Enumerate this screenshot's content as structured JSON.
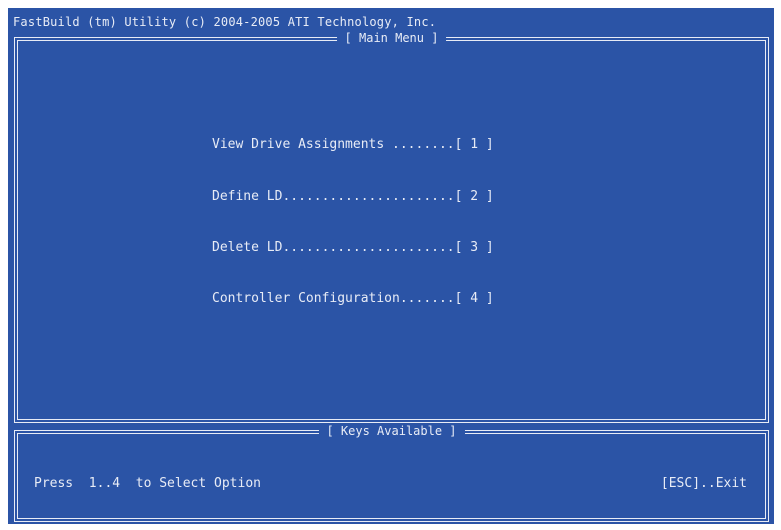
{
  "header": {
    "title": "FastBuild (tm) Utility (c) 2004-2005 ATI Technology, Inc."
  },
  "main_menu": {
    "title": "[ Main Menu ]",
    "items": [
      {
        "label": "View Drive Assignments ........[ 1 ]"
      },
      {
        "label": "Define LD......................[ 2 ]"
      },
      {
        "label": "Delete LD......................[ 3 ]"
      },
      {
        "label": "Controller Configuration.......[ 4 ]"
      }
    ]
  },
  "keys_panel": {
    "title": "[ Keys Available ]",
    "hint": "Press  1..4  to Select Option",
    "exit": "[ESC]..Exit"
  },
  "colors": {
    "background": "#2b54a6",
    "text": "#e8ecf6"
  }
}
